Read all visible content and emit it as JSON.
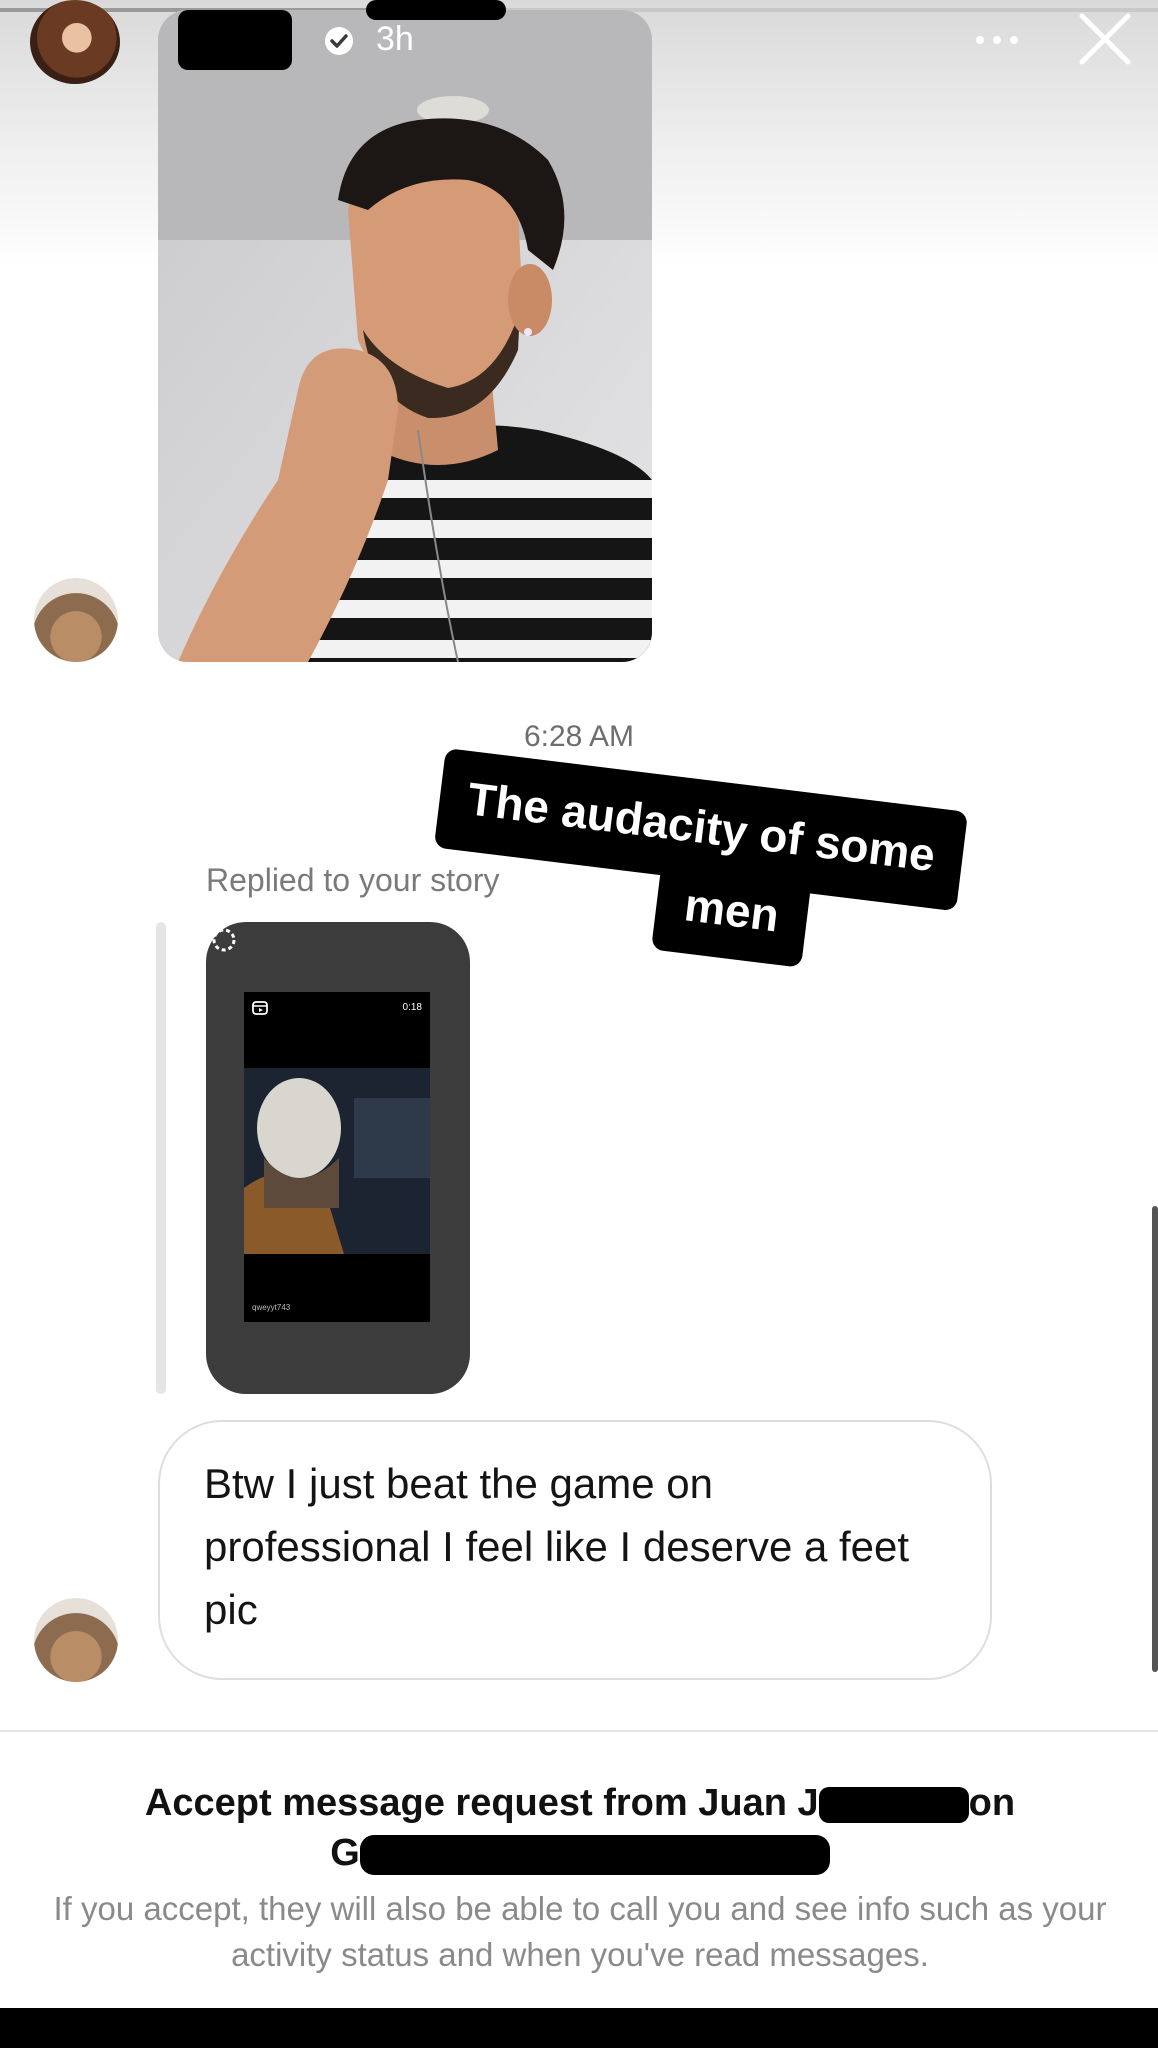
{
  "story_header": {
    "time_ago": "3h",
    "progress_fraction": 0.4
  },
  "conversation": {
    "timestamp": "6:28 AM",
    "reply_label": "Replied to your story",
    "story_preview": {
      "video_time": "0:18",
      "username": "qweyyt743"
    },
    "message": "Btw I just beat the game on professional I feel like I deserve a feet pic"
  },
  "sticker": {
    "line1": "The audacity of some",
    "line2": "men"
  },
  "accept_request": {
    "title_line1": "Accept message request from Juan J",
    "title_line1_end": "on",
    "title_line2": "G",
    "description": "If you accept, they will also be able to call you and see info such as your activity status and when you've read messages."
  },
  "icons": {
    "verified": "verified-badge-icon",
    "more": "more-options-icon",
    "close": "close-icon"
  }
}
